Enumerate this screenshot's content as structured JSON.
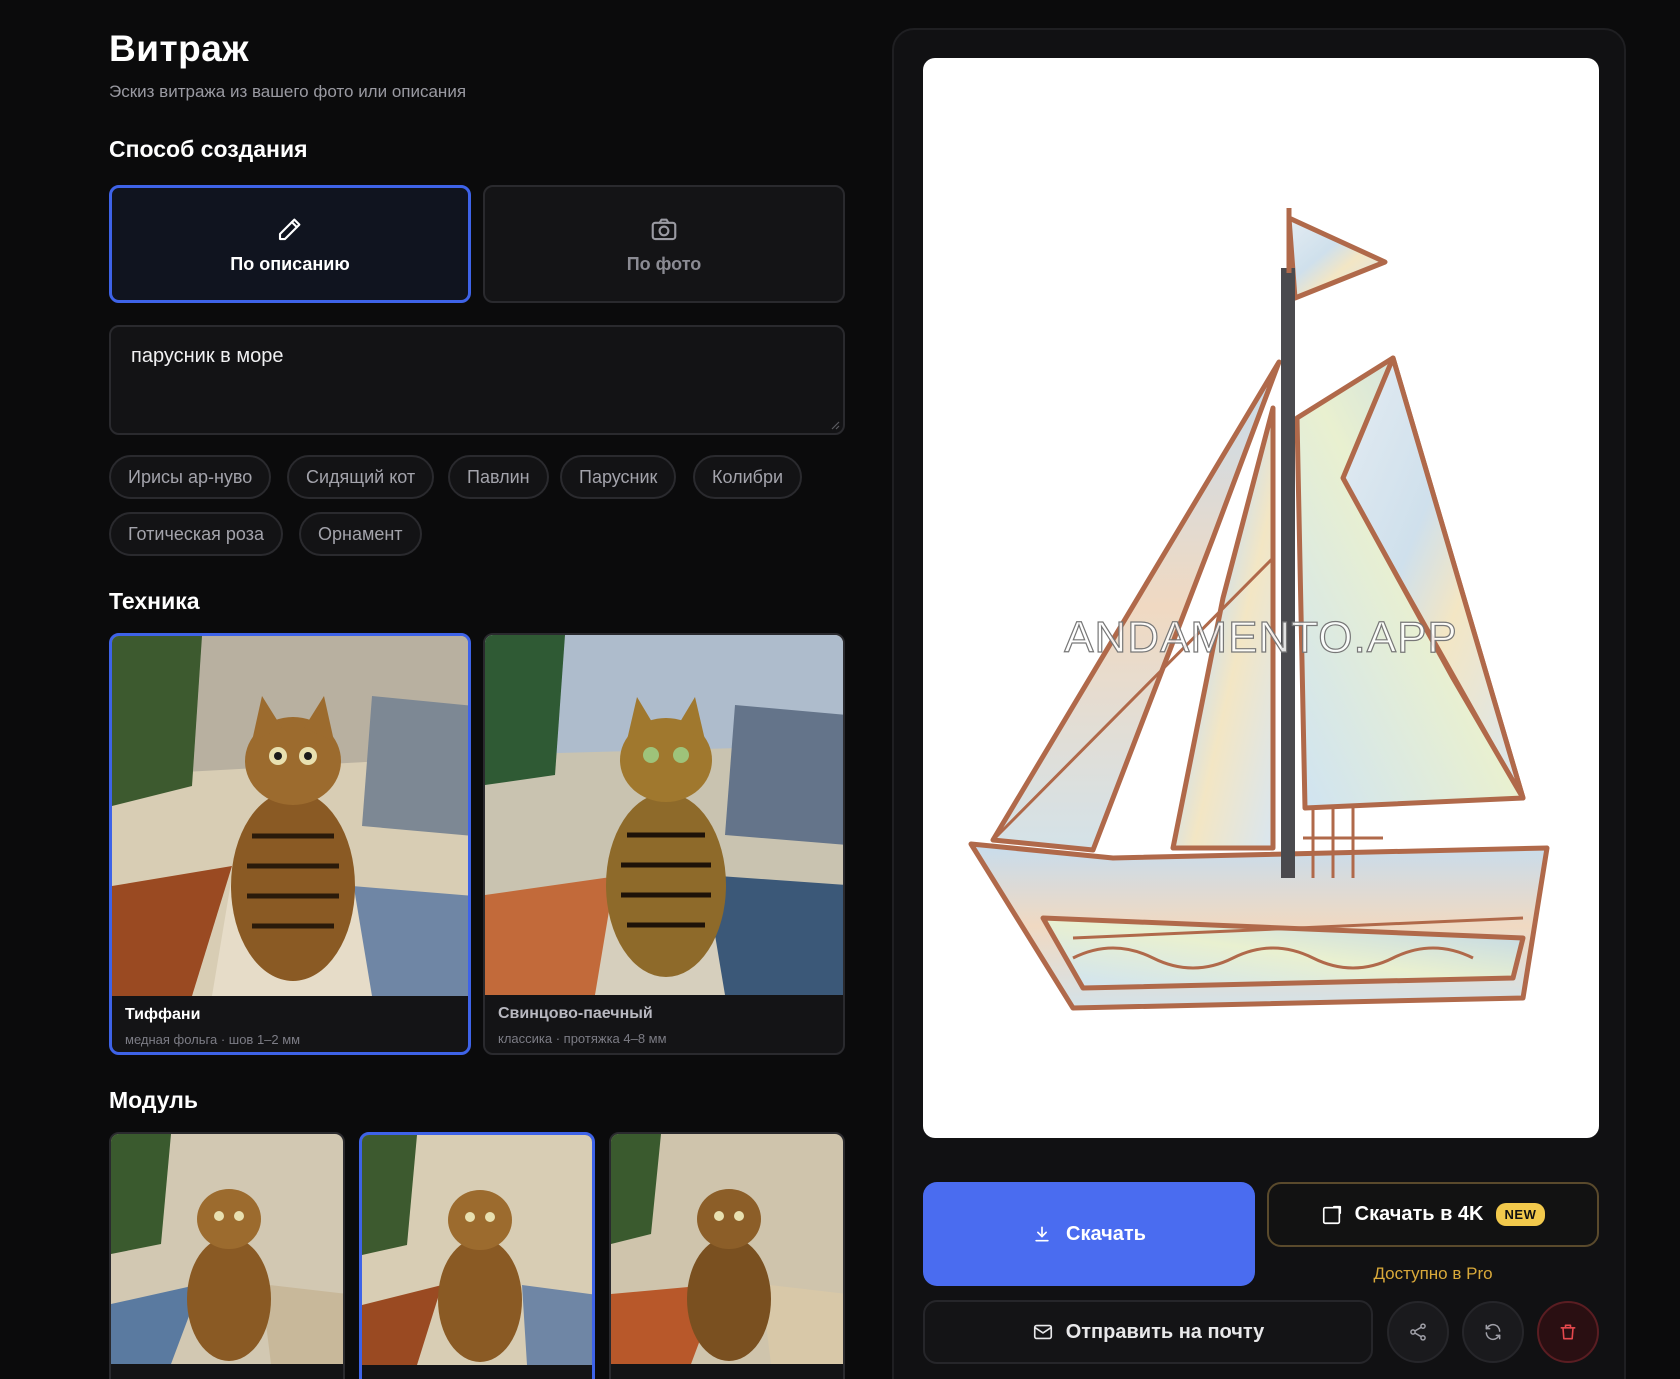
{
  "page": {
    "title": "Витраж",
    "subtitle": "Эскиз витража из вашего фото или описания"
  },
  "creation": {
    "section_title": "Способ создания",
    "modes": [
      {
        "label": "По описанию",
        "icon": "pencil-icon",
        "selected": true
      },
      {
        "label": "По фото",
        "icon": "camera-icon",
        "selected": false
      }
    ],
    "description_value": "парусник в море",
    "presets": [
      "Ирисы ар-нуво",
      "Сидящий кот",
      "Павлин",
      "Парусник",
      "Колибри",
      "Готическая роза",
      "Орнамент"
    ]
  },
  "technique": {
    "section_title": "Техника",
    "options": [
      {
        "name": "Тиффани",
        "desc": "медная фольга · шов 1–2 мм",
        "selected": true
      },
      {
        "name": "Свинцово-паечный",
        "desc": "классика · протяжка 4–8 мм",
        "selected": false
      }
    ]
  },
  "module": {
    "section_title": "Модуль",
    "options_count": 3,
    "selected_index": 1
  },
  "preview": {
    "watermark": "ANDAMENTO.APP"
  },
  "actions": {
    "download_label": "Скачать",
    "download_4k_label": "Скачать в 4K",
    "new_badge": "NEW",
    "pro_note": "Доступно в Pro",
    "email_label": "Отправить на почту",
    "share_icon": "share-icon",
    "regenerate_icon": "refresh-icon",
    "delete_icon": "trash-icon"
  },
  "colors": {
    "accent": "#3e63e8",
    "download_button": "#4a6cf0",
    "pro_note": "#d9a93a",
    "badge_new": "#f2c94c",
    "danger": "#e5484d"
  }
}
